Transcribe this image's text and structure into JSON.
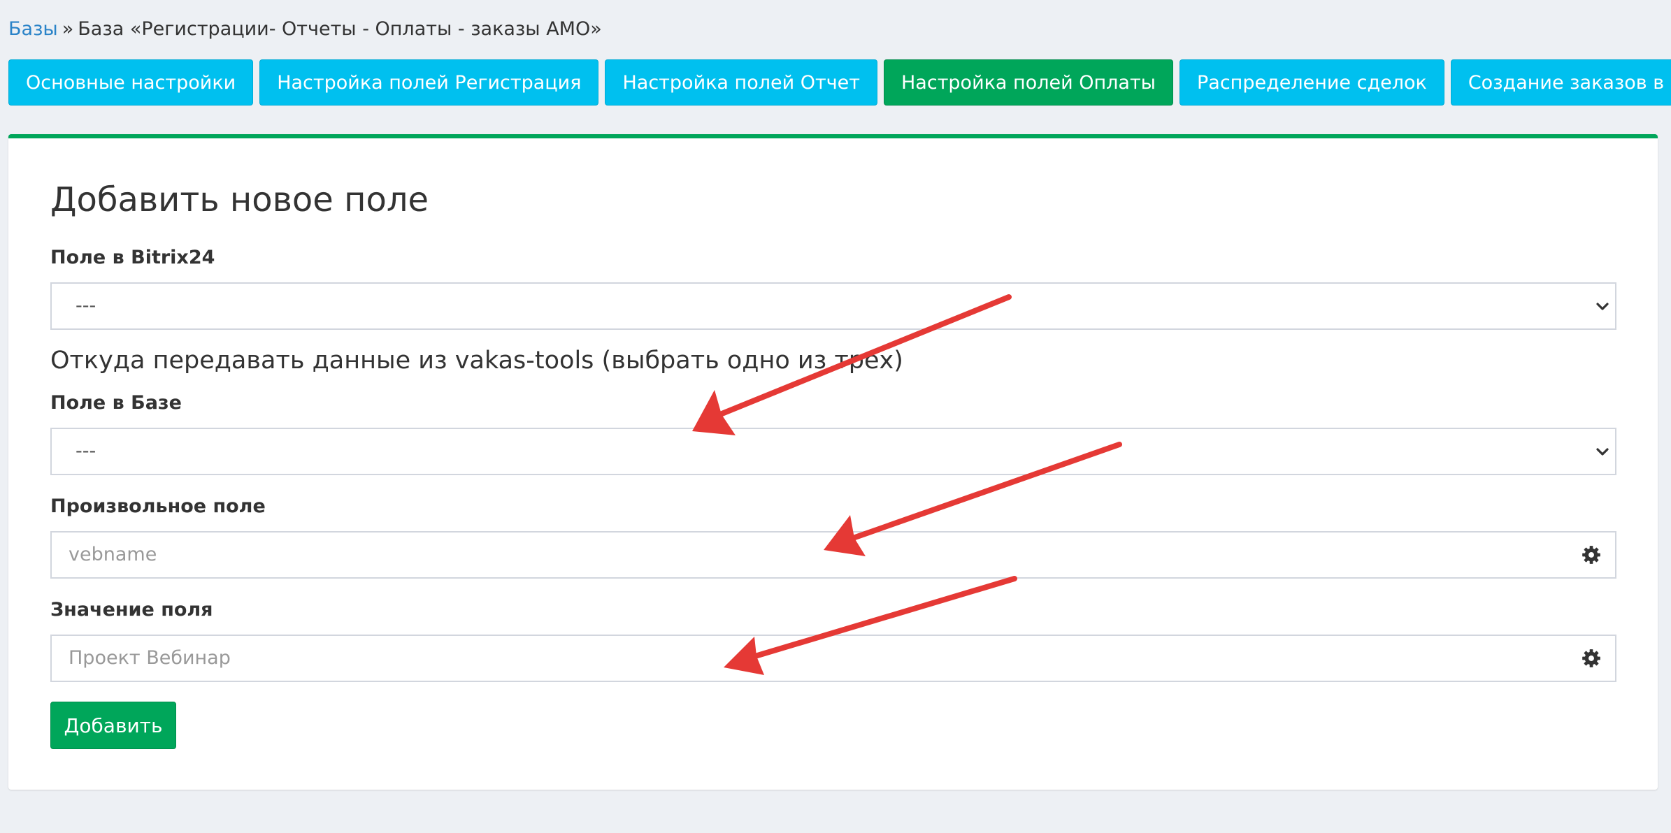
{
  "breadcrumb": {
    "root_link": "Базы",
    "separator": "»",
    "current": "База «Регистрации- Отчеты - Оплаты - заказы АМО»"
  },
  "tabs": [
    {
      "label": "Основные настройки",
      "active": false
    },
    {
      "label": "Настройка полей Регистрация",
      "active": false
    },
    {
      "label": "Настройка полей Отчет",
      "active": false
    },
    {
      "label": "Настройка полей Оплаты",
      "active": true
    },
    {
      "label": "Распределение сделок",
      "active": false
    },
    {
      "label": "Создание заказов в ГК",
      "active": false
    }
  ],
  "form": {
    "title": "Добавить новое поле",
    "bitrix_field": {
      "label": "Поле в Bitrix24",
      "value": "---"
    },
    "source_heading": "Откуда передавать данные из vakas-tools (выбрать одно из трех)",
    "base_field": {
      "label": "Поле в Базе",
      "value": "---"
    },
    "custom_field": {
      "label": "Произвольное поле",
      "placeholder": "vebname",
      "icon": "gear-icon"
    },
    "field_value": {
      "label": "Значение поля",
      "placeholder": "Проект Вебинар",
      "icon": "gear-icon"
    },
    "submit_label": "Добавить"
  },
  "colors": {
    "tab": "#00c0ef",
    "tab_active": "#00a65a",
    "accent_green": "#00a65a",
    "link": "#2a83c8",
    "annotation_arrow": "#e53935",
    "background": "#edf0f4"
  }
}
